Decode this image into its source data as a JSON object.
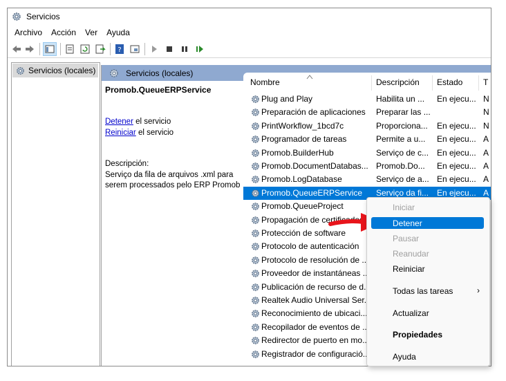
{
  "window": {
    "title": "Servicios"
  },
  "menu": [
    "Archivo",
    "Acción",
    "Ver",
    "Ayuda"
  ],
  "toolbar_icons": [
    "back-icon",
    "forward-icon",
    "console-tree-icon",
    "properties-icon",
    "refresh-icon",
    "export-icon",
    "help-icon",
    "view-icon",
    "play-icon",
    "stop-icon",
    "pause-icon",
    "resume-icon"
  ],
  "tree": {
    "item": "Servicios (locales)"
  },
  "panel": {
    "header": "Servicios (locales)",
    "service_name": "Promob.QueueERPService",
    "stop_link": "Detener",
    "stop_text": " el servicio",
    "restart_link": "Reiniciar",
    "restart_text": " el servicio",
    "description_label": "Descripción:",
    "description_line1": "Serviço da fila de arquivos .xml para",
    "description_line2": "serem processados pelo ERP Promob"
  },
  "columns": {
    "name": "Nombre",
    "description": "Descripción",
    "state": "Estado",
    "type": "T"
  },
  "rows": [
    {
      "name": "Plug and Play",
      "description": "Habilita un ...",
      "state": "En ejecu...",
      "type": "N"
    },
    {
      "name": "Preparación de aplicaciones",
      "description": "Preparar las ...",
      "state": "",
      "type": "N"
    },
    {
      "name": "PrintWorkflow_1bcd7c",
      "description": "Proporciona...",
      "state": "En ejecu...",
      "type": "N"
    },
    {
      "name": "Programador de tareas",
      "description": "Permite a u...",
      "state": "En ejecu...",
      "type": "A"
    },
    {
      "name": "Promob.BuilderHub",
      "description": "Serviço de c...",
      "state": "En ejecu...",
      "type": "A"
    },
    {
      "name": "Promob.DocumentDatabas...",
      "description": "Promob.Do...",
      "state": "En ejecu...",
      "type": "A"
    },
    {
      "name": "Promob.LogDatabase",
      "description": "Serviço de a...",
      "state": "En ejecu...",
      "type": "A"
    },
    {
      "name": "Promob.QueueERPService",
      "description": "Serviço da fi...",
      "state": "En ejecu...",
      "type": "A",
      "selected": true
    },
    {
      "name": "Promob.QueueProject",
      "description": "",
      "state": "",
      "type": ""
    },
    {
      "name": "Propagación de certificados",
      "description": "",
      "state": "",
      "type": ""
    },
    {
      "name": "Protección de software",
      "description": "",
      "state": "",
      "type": ""
    },
    {
      "name": "Protocolo de autenticación",
      "description": "",
      "state": "",
      "type": ""
    },
    {
      "name": "Protocolo de resolución de ...",
      "description": "",
      "state": "",
      "type": ""
    },
    {
      "name": "Proveedor de instantáneas ...",
      "description": "",
      "state": "",
      "type": ""
    },
    {
      "name": "Publicación de recurso de d...",
      "description": "",
      "state": "",
      "type": ""
    },
    {
      "name": "Realtek Audio Universal Ser...",
      "description": "",
      "state": "",
      "type": ""
    },
    {
      "name": "Reconocimiento de ubicaci...",
      "description": "",
      "state": "",
      "type": ""
    },
    {
      "name": "Recopilador de eventos de ...",
      "description": "",
      "state": "",
      "type": ""
    },
    {
      "name": "Redirector de puerto en mo...",
      "description": "",
      "state": "",
      "type": ""
    },
    {
      "name": "Registrador de configuració...",
      "description": "",
      "state": "",
      "type": ""
    }
  ],
  "context_menu": {
    "items": [
      {
        "label": "Iniciar",
        "state": "disabled"
      },
      {
        "label": "Detener",
        "state": "highlighted"
      },
      {
        "label": "Pausar",
        "state": "disabled"
      },
      {
        "label": "Reanudar",
        "state": "disabled"
      },
      {
        "label": "Reiniciar",
        "state": "normal"
      },
      {
        "label": "Todas las tareas",
        "state": "submenu"
      },
      {
        "label": "Actualizar",
        "state": "normal"
      },
      {
        "label": "Propiedades",
        "state": "bold"
      },
      {
        "label": "Ayuda",
        "state": "normal"
      }
    ],
    "submenu_icon": "chevron-right-icon"
  },
  "colors": {
    "selection": "#0078d7",
    "header_band": "#8fa9d0",
    "annotation_arrow": "#e8141b"
  }
}
